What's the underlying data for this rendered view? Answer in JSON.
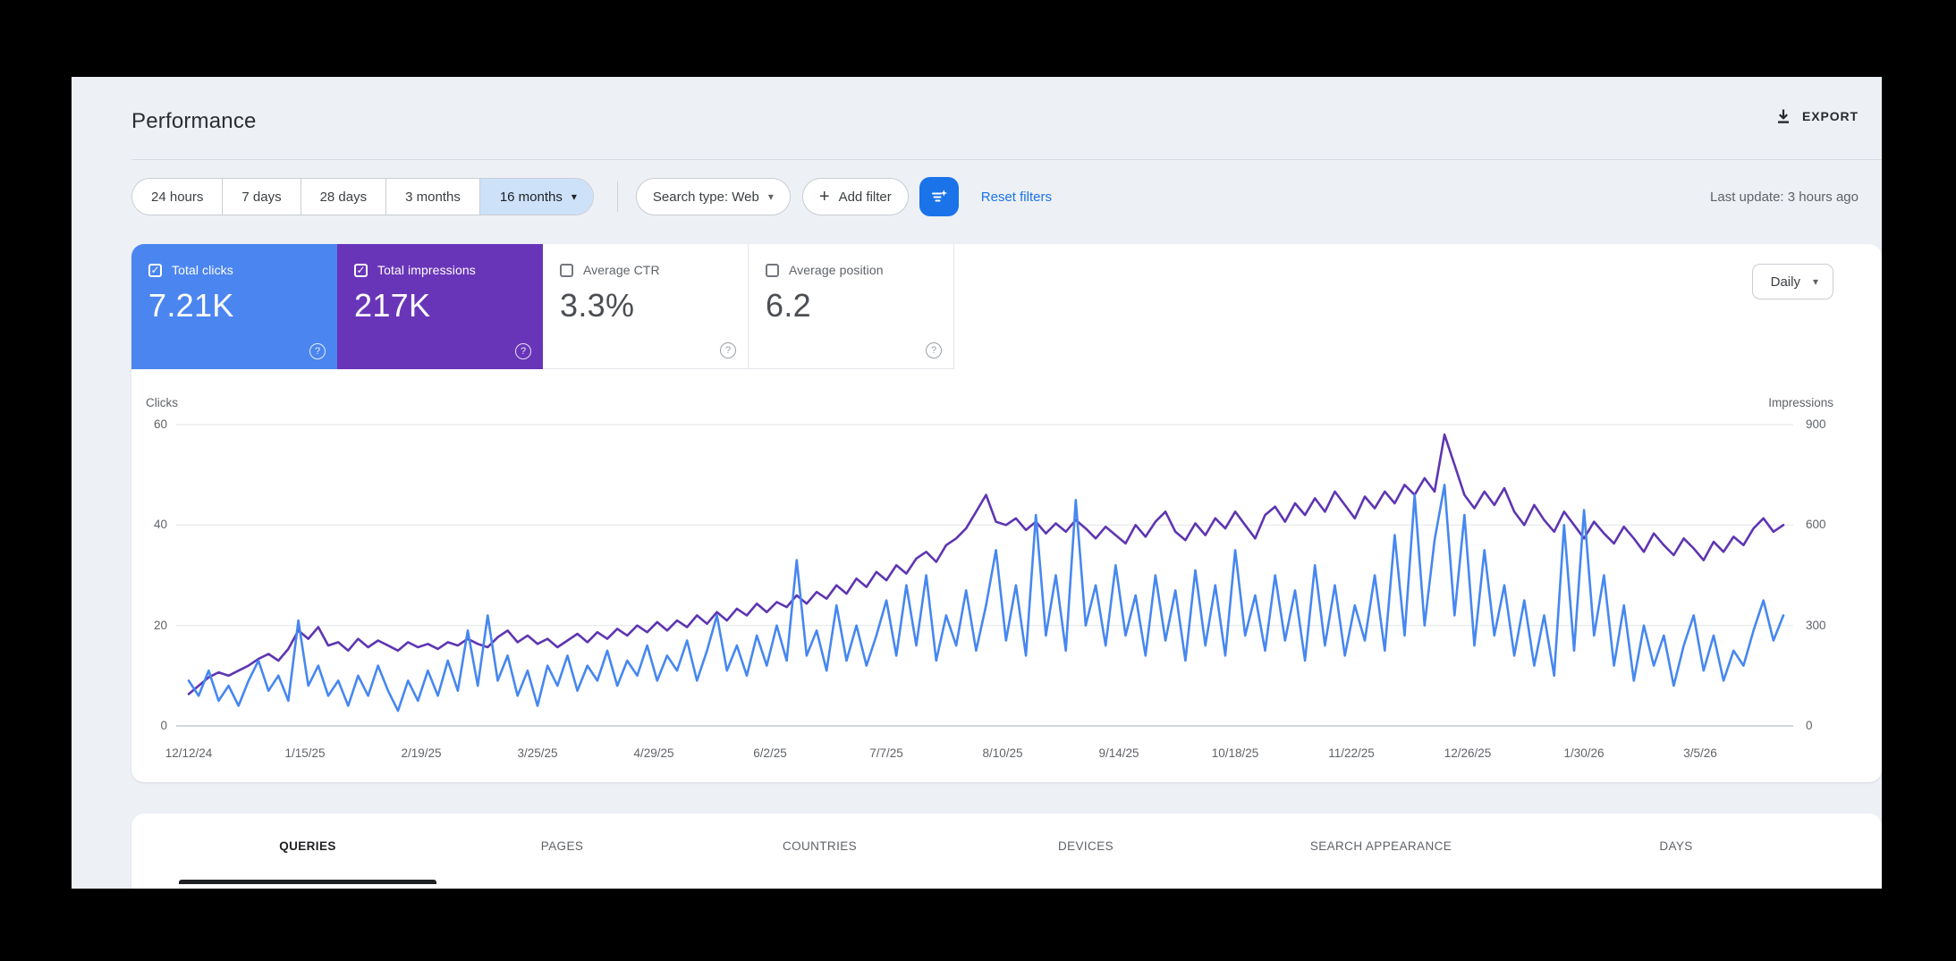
{
  "header": {
    "title": "Performance",
    "export_label": "EXPORT"
  },
  "filters": {
    "ranges": [
      "24 hours",
      "7 days",
      "28 days",
      "3 months",
      "16 months"
    ],
    "selected_range": "16 months",
    "search_type": "Search type: Web",
    "add_filter_label": "Add filter",
    "reset_label": "Reset filters",
    "last_update": "Last update: 3 hours ago"
  },
  "metrics": [
    {
      "label": "Total clicks",
      "value": "7.21K",
      "checked": true,
      "color": "#4b85f0"
    },
    {
      "label": "Total impressions",
      "value": "217K",
      "checked": true,
      "color": "#6935b8"
    },
    {
      "label": "Average CTR",
      "value": "3.3%",
      "checked": false,
      "color": ""
    },
    {
      "label": "Average position",
      "value": "6.2",
      "checked": false,
      "color": ""
    }
  ],
  "granularity": {
    "label": "Daily"
  },
  "tabs": [
    "QUERIES",
    "PAGES",
    "COUNTRIES",
    "DEVICES",
    "SEARCH APPEARANCE",
    "DAYS"
  ],
  "active_tab": "QUERIES",
  "icons": {
    "caret": "▾",
    "check": "✓",
    "help": "?",
    "plus": "+"
  },
  "colors": {
    "accent_blue": "#1a73e8",
    "clicks_blue": "#4687f0",
    "impressions_purple": "#5e35b1",
    "grid": "#e9ebee",
    "axis_line": "#c3c7cd"
  },
  "chart_data": {
    "type": "line",
    "x_labels": [
      "12/12/24",
      "1/15/25",
      "2/19/25",
      "3/25/25",
      "4/29/25",
      "6/2/25",
      "7/7/25",
      "8/10/25",
      "9/14/25",
      "10/18/25",
      "11/22/25",
      "12/26/25",
      "1/30/26",
      "3/5/26"
    ],
    "left_axis": {
      "title": "Clicks",
      "ticks": [
        0,
        20,
        40,
        60
      ],
      "max": 60
    },
    "right_axis": {
      "title": "Impressions",
      "ticks": [
        0,
        300,
        600,
        900
      ],
      "max": 900
    },
    "grid": true,
    "legend_position": "none",
    "series": [
      {
        "name": "Total impressions",
        "axis": "right",
        "color": "#5e35b1",
        "values": [
          95,
          120,
          145,
          160,
          150,
          165,
          180,
          200,
          215,
          195,
          230,
          285,
          260,
          295,
          240,
          250,
          225,
          260,
          235,
          255,
          240,
          225,
          250,
          235,
          245,
          230,
          250,
          240,
          260,
          245,
          235,
          265,
          285,
          250,
          270,
          245,
          260,
          235,
          255,
          275,
          250,
          280,
          260,
          290,
          270,
          300,
          280,
          310,
          285,
          315,
          295,
          330,
          305,
          340,
          315,
          350,
          330,
          365,
          340,
          370,
          355,
          390,
          365,
          400,
          380,
          420,
          395,
          440,
          415,
          460,
          435,
          480,
          455,
          500,
          520,
          490,
          540,
          560,
          590,
          640,
          690,
          610,
          600,
          620,
          585,
          610,
          575,
          605,
          580,
          615,
          590,
          560,
          595,
          570,
          545,
          600,
          565,
          610,
          640,
          580,
          555,
          605,
          570,
          620,
          590,
          640,
          600,
          560,
          630,
          655,
          610,
          665,
          630,
          680,
          640,
          700,
          660,
          620,
          685,
          650,
          700,
          665,
          720,
          690,
          740,
          700,
          870,
          780,
          690,
          650,
          700,
          660,
          710,
          640,
          600,
          660,
          615,
          580,
          640,
          600,
          560,
          610,
          575,
          545,
          595,
          560,
          520,
          575,
          540,
          510,
          560,
          530,
          495,
          550,
          520,
          565,
          540,
          590,
          620,
          580,
          600
        ]
      },
      {
        "name": "Total clicks",
        "axis": "left",
        "color": "#4687f0",
        "values": [
          9,
          6,
          11,
          5,
          8,
          4,
          9,
          13,
          7,
          10,
          5,
          21,
          8,
          12,
          6,
          9,
          4,
          10,
          6,
          12,
          7,
          3,
          9,
          5,
          11,
          6,
          13,
          7,
          19,
          8,
          22,
          9,
          14,
          6,
          11,
          4,
          12,
          8,
          14,
          7,
          12,
          9,
          15,
          8,
          13,
          10,
          16,
          9,
          14,
          11,
          17,
          9,
          15,
          22,
          11,
          16,
          10,
          18,
          12,
          20,
          13,
          33,
          14,
          19,
          11,
          24,
          13,
          20,
          12,
          18,
          25,
          14,
          28,
          16,
          30,
          13,
          22,
          16,
          27,
          15,
          24,
          35,
          17,
          28,
          14,
          42,
          18,
          30,
          15,
          45,
          20,
          28,
          16,
          32,
          18,
          26,
          14,
          30,
          17,
          27,
          13,
          31,
          16,
          28,
          14,
          35,
          18,
          26,
          15,
          30,
          17,
          27,
          13,
          32,
          16,
          28,
          14,
          24,
          17,
          30,
          15,
          38,
          18,
          46,
          20,
          37,
          48,
          22,
          42,
          16,
          35,
          18,
          28,
          14,
          25,
          12,
          22,
          10,
          40,
          15,
          43,
          18,
          30,
          12,
          24,
          9,
          20,
          12,
          18,
          8,
          16,
          22,
          11,
          18,
          9,
          15,
          12,
          19,
          25,
          17,
          22
        ]
      }
    ]
  }
}
